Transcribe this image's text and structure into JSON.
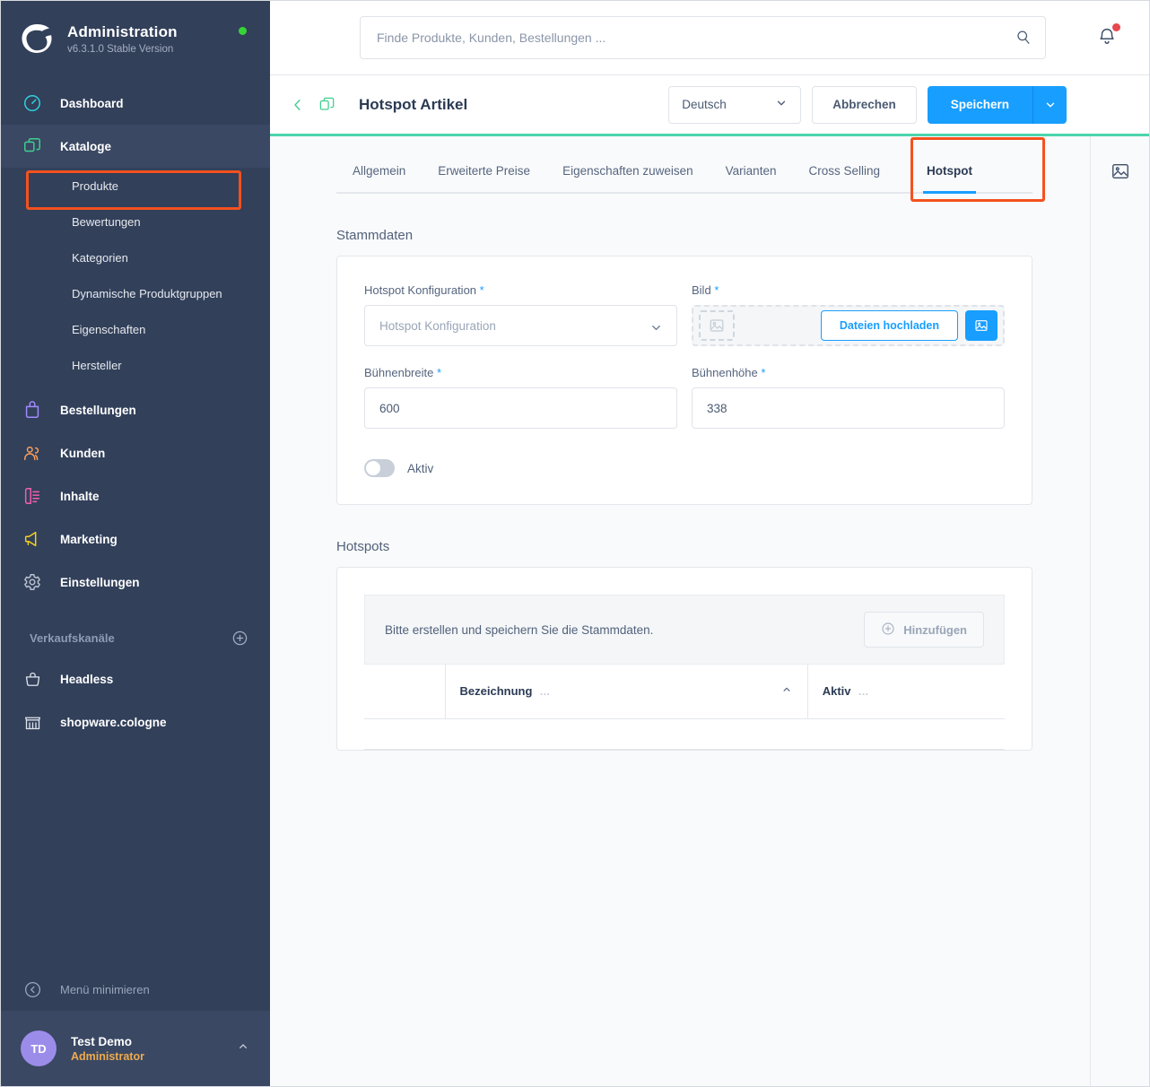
{
  "sidebar": {
    "brand": {
      "title": "Administration",
      "version": "v6.3.1.0 Stable Version",
      "logo_icon": "shopware-logo-icon",
      "status_icon": "status-online-dot"
    },
    "items": [
      {
        "label": "Dashboard",
        "icon": "dashboard-speedometer-icon"
      },
      {
        "label": "Kataloge",
        "icon": "catalog-stack-icon"
      },
      {
        "label": "Bestellungen",
        "icon": "orders-bag-icon"
      },
      {
        "label": "Kunden",
        "icon": "customers-people-icon"
      },
      {
        "label": "Inhalte",
        "icon": "content-document-icon"
      },
      {
        "label": "Marketing",
        "icon": "marketing-megaphone-icon"
      },
      {
        "label": "Einstellungen",
        "icon": "settings-gear-icon"
      }
    ],
    "subitems": [
      {
        "label": "Produkte"
      },
      {
        "label": "Bewertungen"
      },
      {
        "label": "Kategorien"
      },
      {
        "label": "Dynamische Produktgruppen"
      },
      {
        "label": "Eigenschaften"
      },
      {
        "label": "Hersteller"
      }
    ],
    "sales_channels": {
      "label": "Verkaufskanäle",
      "add_icon": "plus-circle-icon",
      "items": [
        {
          "label": "Headless",
          "icon": "basket-icon"
        },
        {
          "label": "shopware.cologne",
          "icon": "storefront-icon"
        }
      ]
    },
    "minimize": {
      "label": "Menü minimieren",
      "icon": "chevron-left-circle-icon"
    },
    "user": {
      "initials": "TD",
      "name": "Test Demo",
      "role": "Administrator",
      "caret_icon": "chevron-up-icon"
    }
  },
  "topbar": {
    "search": {
      "placeholder": "Finde Produkte, Kunden, Bestellungen ...",
      "value": "",
      "icon": "search-icon"
    },
    "notifications": {
      "icon": "bell-icon",
      "has_unread": true
    }
  },
  "header": {
    "back_icon": "chevron-left-icon",
    "duplicate_icon": "duplicate-icon",
    "title": "Hotspot Artikel",
    "language": {
      "value": "Deutsch",
      "caret_icon": "chevron-down-icon"
    },
    "cancel_label": "Abbrechen",
    "save_label": "Speichern",
    "save_caret_icon": "chevron-down-icon"
  },
  "tabs": [
    {
      "label": "Allgemein"
    },
    {
      "label": "Erweiterte Preise"
    },
    {
      "label": "Eigenschaften zuweisen"
    },
    {
      "label": "Varianten"
    },
    {
      "label": "Cross Selling"
    },
    {
      "label": "Hotspot"
    }
  ],
  "stammdaten": {
    "section_title": "Stammdaten",
    "hotspot_config": {
      "label": "Hotspot Konfiguration",
      "required": "*",
      "placeholder": "Hotspot Konfiguration",
      "value": "",
      "caret_icon": "chevron-down-icon"
    },
    "image": {
      "label": "Bild",
      "required": "*",
      "placeholder_icon": "image-placeholder-icon",
      "upload_label": "Dateien hochladen",
      "media_icon": "media-image-icon"
    },
    "width": {
      "label": "Bühnenbreite",
      "required": "*",
      "value": "600"
    },
    "height": {
      "label": "Bühnenhöhe",
      "required": "*",
      "value": "338"
    },
    "active": {
      "label": "Aktiv",
      "checked": false
    }
  },
  "hotspots": {
    "section_title": "Hotspots",
    "empty_text": "Bitte erstellen und speichern Sie die Stammdaten.",
    "add_label": "Hinzufügen",
    "add_icon": "plus-circle-icon",
    "columns": [
      {
        "label": "Bezeichnung",
        "menu_icon": "ellipsis-icon",
        "sort_icon": "chevron-up-icon"
      },
      {
        "label": "Aktiv",
        "menu_icon": "ellipsis-icon"
      }
    ]
  },
  "rightbar": {
    "media_icon": "media-image-icon"
  },
  "colors": {
    "sidebar_bg": "#32405a",
    "accent_blue": "#189eff",
    "accent_green": "#4dd4ac",
    "highlight_orange": "#f4511e",
    "role_orange": "#eeaa4d"
  }
}
